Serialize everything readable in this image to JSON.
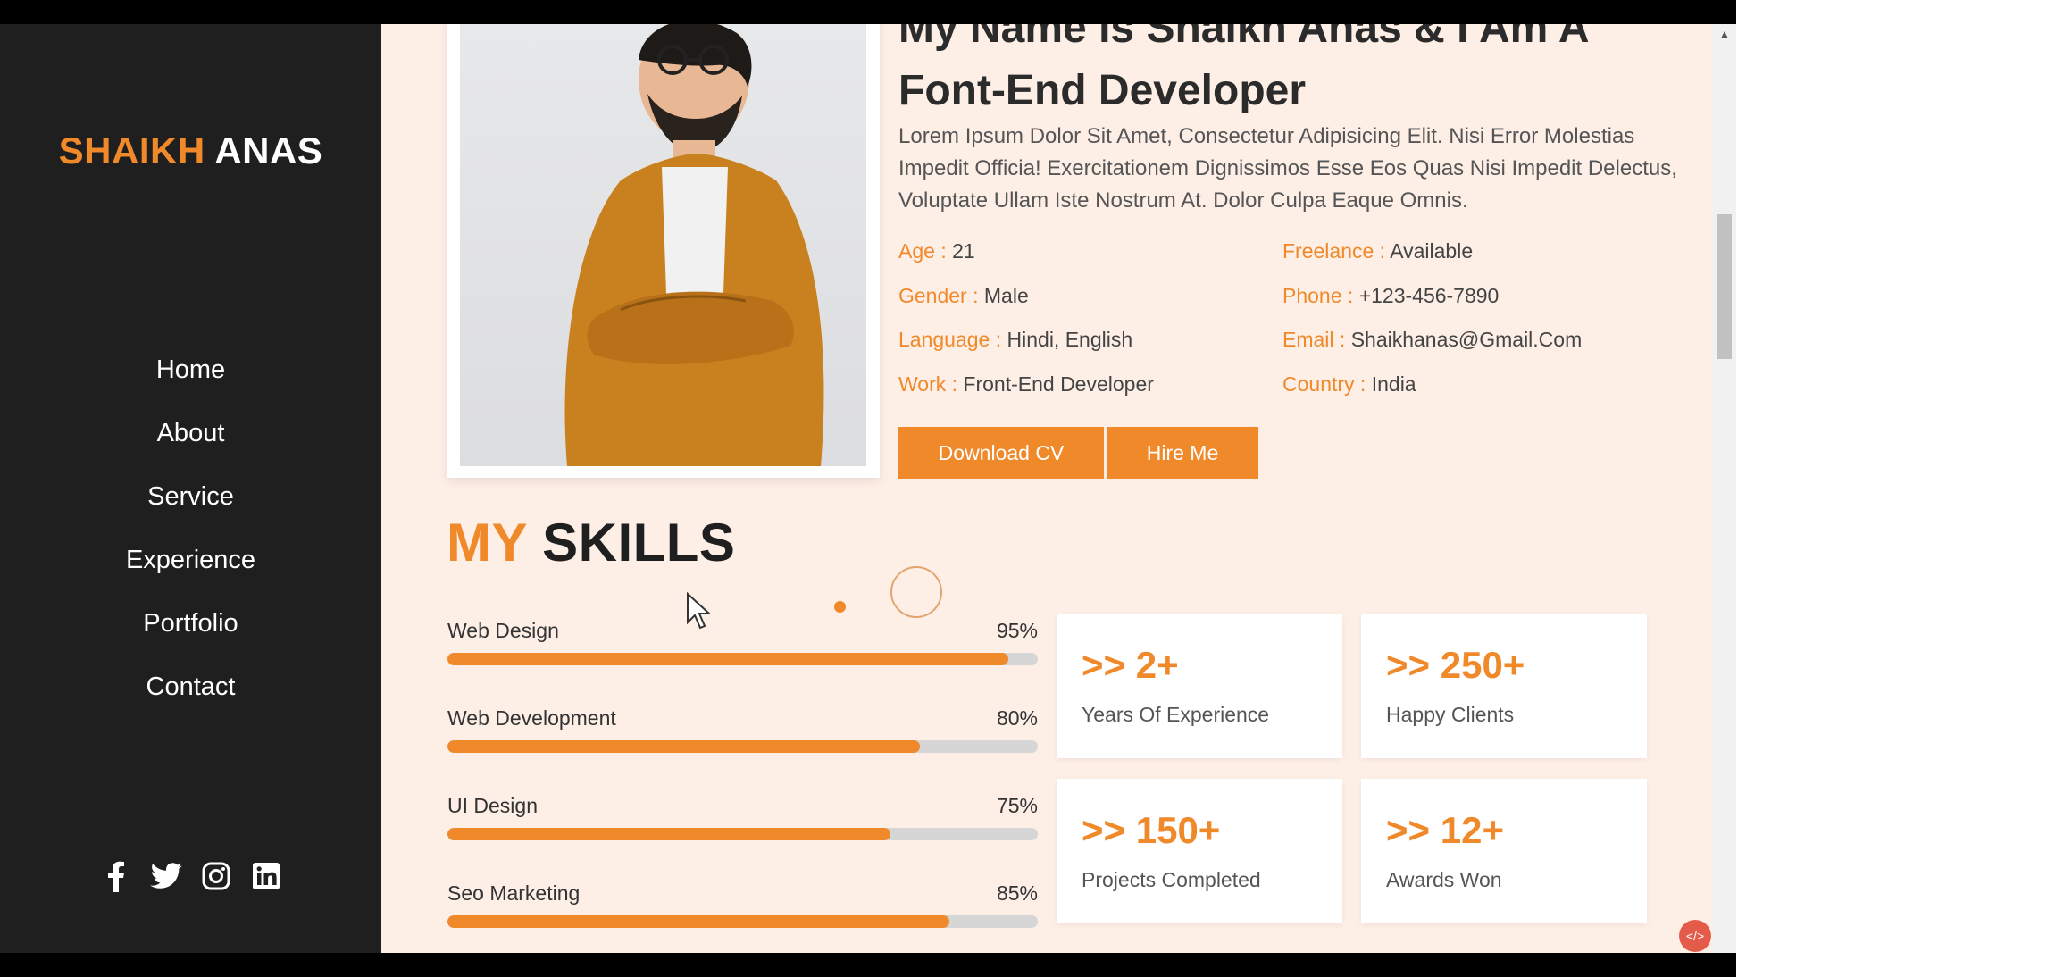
{
  "sidebar": {
    "logo_first": "SHAIKH",
    "logo_second": "ANAS",
    "nav": [
      "Home",
      "About",
      "Service",
      "Experience",
      "Portfolio",
      "Contact"
    ],
    "social_icons": [
      "facebook-icon",
      "twitter-icon",
      "instagram-icon",
      "linkedin-icon"
    ]
  },
  "about": {
    "heading_line1": "My Name Is Shaikh Anas & I Am A",
    "heading_line2": "Font-End Developer",
    "description": "Lorem Ipsum Dolor Sit Amet, Consectetur Adipisicing Elit. Nisi Error Molestias Impedit Officia! Exercitationem Dignissimos Esse Eos Quas Nisi Impedit Delectus, Voluptate Ullam Iste Nostrum At. Dolor Culpa Eaque Omnis.",
    "info_left": [
      {
        "key": "Age :",
        "value": "21"
      },
      {
        "key": "Gender :",
        "value": "Male"
      },
      {
        "key": "Language :",
        "value": "Hindi, English"
      },
      {
        "key": "Work :",
        "value": "Front-End Developer"
      }
    ],
    "info_right": [
      {
        "key": "Freelance :",
        "value": "Available"
      },
      {
        "key": "Phone :",
        "value": "+123-456-7890"
      },
      {
        "key": "Email :",
        "value": "Shaikhanas@Gmail.Com"
      },
      {
        "key": "Country :",
        "value": "India"
      }
    ],
    "download_cv": "Download CV",
    "hire_me": "Hire Me"
  },
  "skills": {
    "title_accent": "MY",
    "title_rest": "SKILLS",
    "items": [
      {
        "name": "Web Design",
        "percent": "95%",
        "level": 0.95
      },
      {
        "name": "Web Development",
        "percent": "80%",
        "level": 0.8
      },
      {
        "name": "UI Design",
        "percent": "75%",
        "level": 0.75
      },
      {
        "name": "Seo Marketing",
        "percent": "85%",
        "level": 0.85
      }
    ],
    "stats": [
      {
        "number": ">> 2+",
        "label": "Years Of Experience"
      },
      {
        "number": ">> 250+",
        "label": "Happy Clients"
      },
      {
        "number": ">> 150+",
        "label": "Projects Completed"
      },
      {
        "number": ">> 12+",
        "label": "Awards Won"
      }
    ]
  },
  "colors": {
    "accent": "#f0892a",
    "sidebar": "#1f1f1f",
    "background": "#fdeee6"
  }
}
